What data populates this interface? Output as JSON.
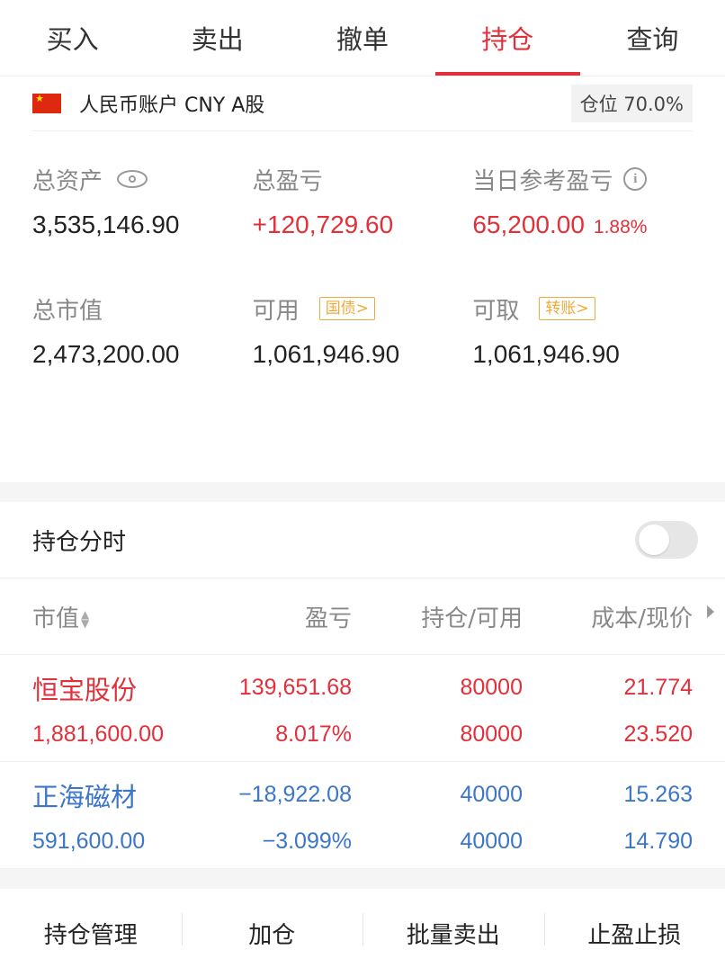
{
  "tabs": [
    "买入",
    "卖出",
    "撤单",
    "持仓",
    "查询"
  ],
  "active_tab": "持仓",
  "account": {
    "label": "人民币账户 CNY A股",
    "position": "仓位 70.0%"
  },
  "assets": {
    "total_assets": {
      "label": "总资产",
      "value": "3,535,146.90"
    },
    "total_pnl": {
      "label": "总盈亏",
      "value": "+120,729.60"
    },
    "daily_pnl": {
      "label": "当日参考盈亏",
      "value": "65,200.00",
      "pct": "1.88%"
    },
    "market_value": {
      "label": "总市值",
      "value": "2,473,200.00"
    },
    "available": {
      "label": "可用",
      "tag": "国债>",
      "value": "1,061,946.90"
    },
    "withdrawable": {
      "label": "可取",
      "tag": "转账>",
      "value": "1,061,946.90"
    }
  },
  "timeshare": {
    "label": "持仓分时",
    "enabled": false
  },
  "table": {
    "headers": [
      "市值",
      "盈亏",
      "持仓/可用",
      "成本/现价"
    ],
    "rows": [
      {
        "name": "恒宝股份",
        "market_value": "1,881,600.00",
        "pnl": "139,651.68",
        "pnl_pct": "8.017%",
        "holding": "80000",
        "available": "80000",
        "cost": "21.774",
        "price": "23.520",
        "color": "#e2303b"
      },
      {
        "name": "正海磁材",
        "market_value": "591,600.00",
        "pnl": "−18,922.08",
        "pnl_pct": "−3.099%",
        "holding": "40000",
        "available": "40000",
        "cost": "15.263",
        "price": "14.790",
        "color": "#3b76c8"
      }
    ]
  },
  "actions": [
    "持仓管理",
    "加仓",
    "批量卖出",
    "止盈止损"
  ],
  "colors": {
    "accent": "#e2303b",
    "loss": "#3b76c8",
    "tag": "#f0a93b"
  }
}
